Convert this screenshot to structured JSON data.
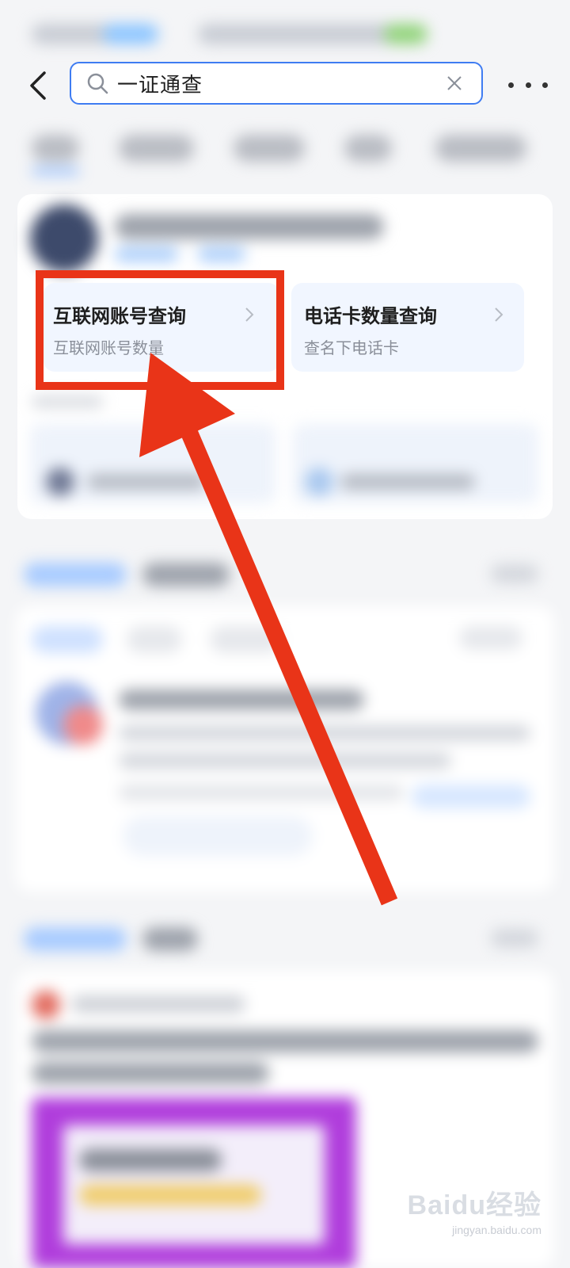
{
  "search": {
    "query": "一证通查"
  },
  "icons": {
    "back": "back-arrow-icon",
    "search": "search-icon",
    "clear": "close-icon",
    "more": "more-dots-icon",
    "chevron": "chevron-right-icon"
  },
  "quick_tiles": [
    {
      "title": "互联网账号查询",
      "subtitle": "互联网账号数量"
    },
    {
      "title": "电话卡数量查询",
      "subtitle": "查名下电话卡"
    }
  ],
  "colors": {
    "accent": "#3f7cf2",
    "annotation": "#e93418",
    "tile_bg": "#f1f6ff"
  },
  "watermark": {
    "logo": "Baidu经验",
    "url": "jingyan.baidu.com"
  }
}
